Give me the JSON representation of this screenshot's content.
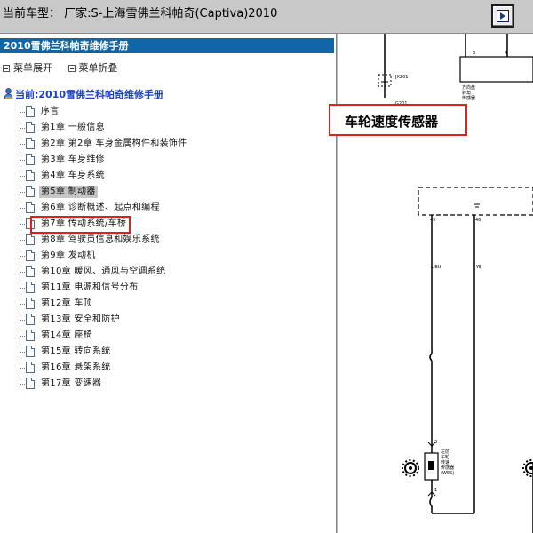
{
  "titlebar": {
    "title": "当前车型：  厂家:S-上海雪佛兰科帕奇(Captiva)2010",
    "nav_button_icon": "export-arrow-icon"
  },
  "left_panel": {
    "header": "2010雪佛兰科帕奇维修手册",
    "controls": [
      {
        "label": "菜单展开",
        "icon": "expand-icon"
      },
      {
        "label": "菜单折叠",
        "icon": "collapse-icon"
      }
    ],
    "tree_root": "当前:2010雪佛兰科帕奇维修手册",
    "items": [
      {
        "label": "序言"
      },
      {
        "label": "第1章 一般信息"
      },
      {
        "label": "第2章 第2章 车身金属构件和装饰件"
      },
      {
        "label": "第3章 车身维修"
      },
      {
        "label": "第4章 车身系统"
      },
      {
        "label": "第5章 制动器",
        "selected": true
      },
      {
        "label": "第6章 诊断概述、起点和编程"
      },
      {
        "label": "第7章 传动系统/车桥"
      },
      {
        "label": "第8章 驾驶员信息和娱乐系统"
      },
      {
        "label": "第9章 发动机"
      },
      {
        "label": "第10章 暖风、通风与空调系统"
      },
      {
        "label": "第11章 电源和信号分布"
      },
      {
        "label": "第12章 车顶"
      },
      {
        "label": "第13章 安全和防护"
      },
      {
        "label": "第14章 座椅"
      },
      {
        "label": "第15章 转向系统"
      },
      {
        "label": "第16章 悬架系统"
      },
      {
        "label": "第17章 变速器"
      }
    ],
    "highlight_color": "#e0201c"
  },
  "diagram": {
    "callout": "车轮速度传感器",
    "labels": {
      "pin3": "3",
      "pin4": "4",
      "jx201": "JX201",
      "g201": "G201",
      "steering_caption": [
        "方向盘",
        "转角",
        "传感器"
      ],
      "pin45": "45",
      "pin46": "46",
      "wire_lbu": "L-BU",
      "wire_ye": "YE",
      "pin2": "2",
      "pin1": "1",
      "sensor_caption": [
        "左前",
        "车轮",
        "转速",
        "传感器",
        "(WSS)"
      ]
    }
  },
  "colors": {
    "header_bg": "#1066a6",
    "root_label": "#1a3fc9",
    "titlebar_bg": "#c9c9c9"
  }
}
